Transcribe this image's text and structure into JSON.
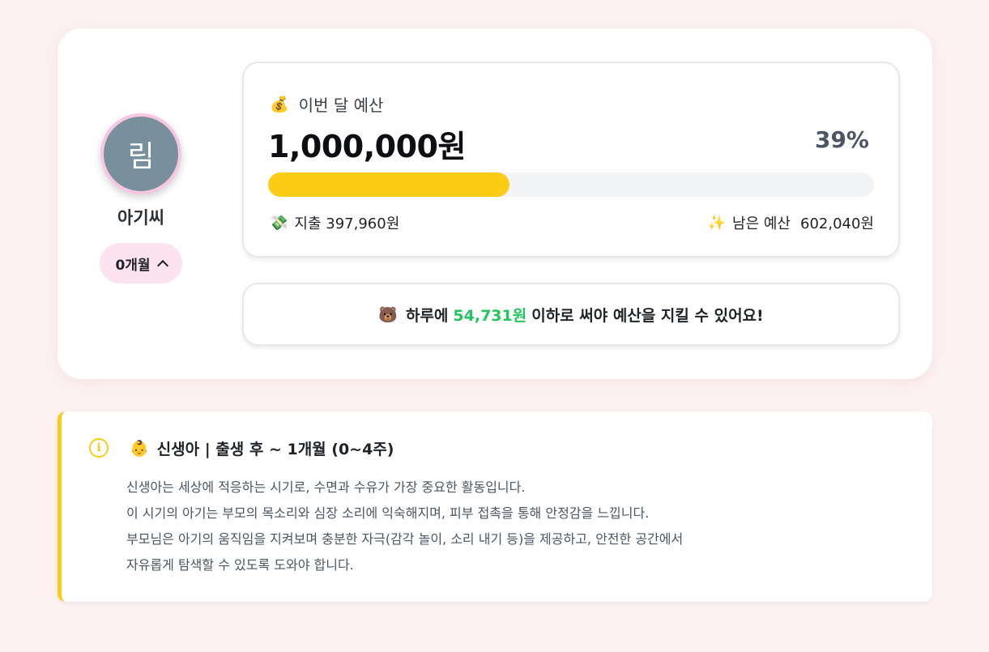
{
  "profile": {
    "avatar_initial": "림",
    "name": "아기씨",
    "age_label": "0개월"
  },
  "budget": {
    "title_emoji": "💰",
    "title": "이번 달 예산",
    "amount": "1,000,000원",
    "percent_text": "39%",
    "percent_value": 39.8,
    "spent_emoji": "💸",
    "spent_label": "지출 397,960원",
    "remain_emoji": "✨",
    "remain_label": "남은 예산",
    "remain_amount": "602,040원",
    "bar_color": "#facc15"
  },
  "daily": {
    "emoji": "🐻",
    "prefix": "하루에",
    "amount": "54,731원",
    "suffix": "이하로 써야 예산을 지킬 수 있어요!",
    "highlight_color": "#22c55e"
  },
  "info": {
    "icon": "info-circle-icon",
    "title_emoji": "👶",
    "title": "신생아 | 출생 후 ~ 1개월 (0~4주)",
    "lines": [
      "신생아는 세상에 적응하는 시기로, 수면과 수유가 가장 중요한 활동입니다.",
      "이 시기의 아기는 부모의 목소리와 심장 소리에 익숙해지며, 피부 접촉을 통해 안정감을 느낍니다.",
      "부모님은 아기의 움직임을 지켜보며 충분한 자극(감각 놀이, 소리 내기 등)을 제공하고, 안전한 공간에서",
      "자유롭게 탐색할 수 있도록 도와야 합니다."
    ],
    "accent_color": "#facc15"
  }
}
